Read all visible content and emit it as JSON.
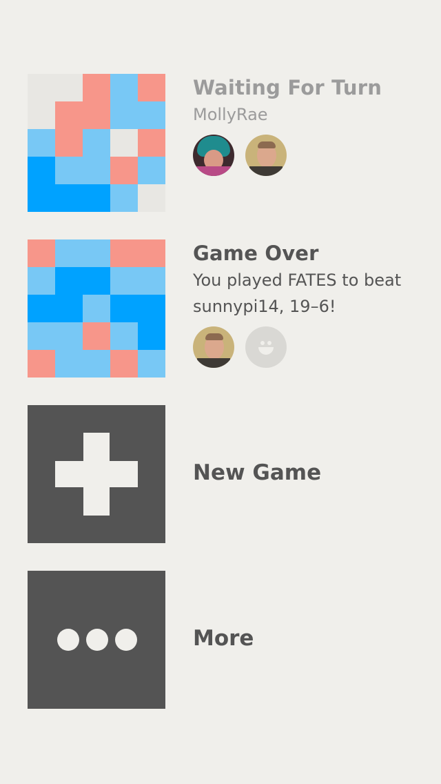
{
  "colors": {
    "background": "#f0efeb",
    "dark_tile": "#545454",
    "red": "#f7968a",
    "light_blue": "#78c8f5",
    "blue": "#00a2ff",
    "neutral": "#e8e7e3",
    "muted_text": "#9b9b9b",
    "text": "#545454"
  },
  "games": [
    {
      "title": "Waiting For Turn",
      "subtitle": "MollyRae",
      "board": [
        [
          "neutral",
          "neutral",
          "red",
          "light_blue",
          "red"
        ],
        [
          "neutral",
          "red",
          "red",
          "light_blue",
          "light_blue"
        ],
        [
          "light_blue",
          "red",
          "light_blue",
          "neutral",
          "red"
        ],
        [
          "blue",
          "light_blue",
          "light_blue",
          "red",
          "light_blue"
        ],
        [
          "blue",
          "blue",
          "blue",
          "light_blue",
          "neutral"
        ]
      ],
      "players": [
        "woman-avatar",
        "man-avatar"
      ]
    },
    {
      "title": "Game Over",
      "description_line1": "You played FATES to beat",
      "description_line2": "sunnypi14, 19–6!",
      "board": [
        [
          "red",
          "light_blue",
          "light_blue",
          "red",
          "red"
        ],
        [
          "light_blue",
          "blue",
          "blue",
          "light_blue",
          "light_blue"
        ],
        [
          "blue",
          "blue",
          "light_blue",
          "blue",
          "blue"
        ],
        [
          "light_blue",
          "light_blue",
          "red",
          "light_blue",
          "blue"
        ],
        [
          "red",
          "light_blue",
          "light_blue",
          "red",
          "light_blue"
        ]
      ],
      "players": [
        "man-avatar",
        "placeholder-avatar"
      ]
    }
  ],
  "actions": {
    "new_game": {
      "label": "New Game",
      "icon": "plus-icon"
    },
    "more": {
      "label": "More",
      "icon": "ellipsis-icon"
    }
  }
}
